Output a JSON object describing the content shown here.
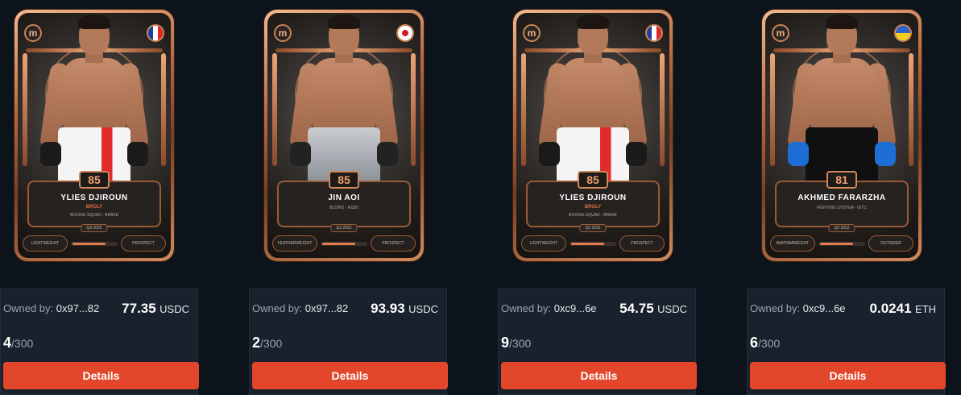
{
  "cards": [
    {
      "rating": "85",
      "name": "YLIES DJIROUN",
      "nickname": "BROLY",
      "club": "BOXING SQUAD - BRAVE",
      "season": "Q3 2022",
      "weight_class": "LIGHTWEIGHT",
      "tier": "PROSPECT",
      "flag_icon": "france-flag-icon",
      "owner_label": "Owned by:",
      "owner_address": "0x97...82",
      "price_value": "77.35",
      "price_currency": "USDC",
      "edition_number": "4",
      "edition_total": "/300",
      "details_label": "Details"
    },
    {
      "rating": "85",
      "name": "JIN AOI",
      "nickname": "",
      "club": "BLOWS - RIZIN",
      "season": "Q3 2022",
      "weight_class": "FEATHERWEIGHT",
      "tier": "PROSPECT",
      "flag_icon": "japan-flag-icon",
      "owner_label": "Owned by:",
      "owner_address": "0x97...82",
      "price_value": "93.93",
      "price_currency": "USDC",
      "edition_number": "2",
      "edition_total": "/300",
      "details_label": "Details"
    },
    {
      "rating": "85",
      "name": "YLIES DJIROUN",
      "nickname": "BROLY",
      "club": "BOXING SQUAD - BRAVE",
      "season": "Q3 2022",
      "weight_class": "LIGHTWEIGHT",
      "tier": "PROSPECT",
      "flag_icon": "france-flag-icon",
      "owner_label": "Owned by:",
      "owner_address": "0xc9...6e",
      "price_value": "54.75",
      "price_currency": "USDC",
      "edition_number": "9",
      "edition_total": "/300",
      "details_label": "Details"
    },
    {
      "rating": "81",
      "name": "AKHMED FARARZHA",
      "nickname": "",
      "club": "FIGHTING SYSTEM - GITC",
      "season": "Q3 2022",
      "weight_class": "BANTAMWEIGHT",
      "tier": "OUTSIDER",
      "flag_icon": "ukraine-flag-icon",
      "owner_label": "Owned by:",
      "owner_address": "0xc9...6e",
      "price_value": "0.0241",
      "price_currency": "ETH",
      "edition_number": "6",
      "edition_total": "/300",
      "details_label": "Details"
    }
  ],
  "brand_mark": "m",
  "colors": {
    "accent_button": "#e2472b",
    "panel_bg": "#18212c",
    "page_bg": "#0d131a",
    "copper": "#d1895b"
  }
}
